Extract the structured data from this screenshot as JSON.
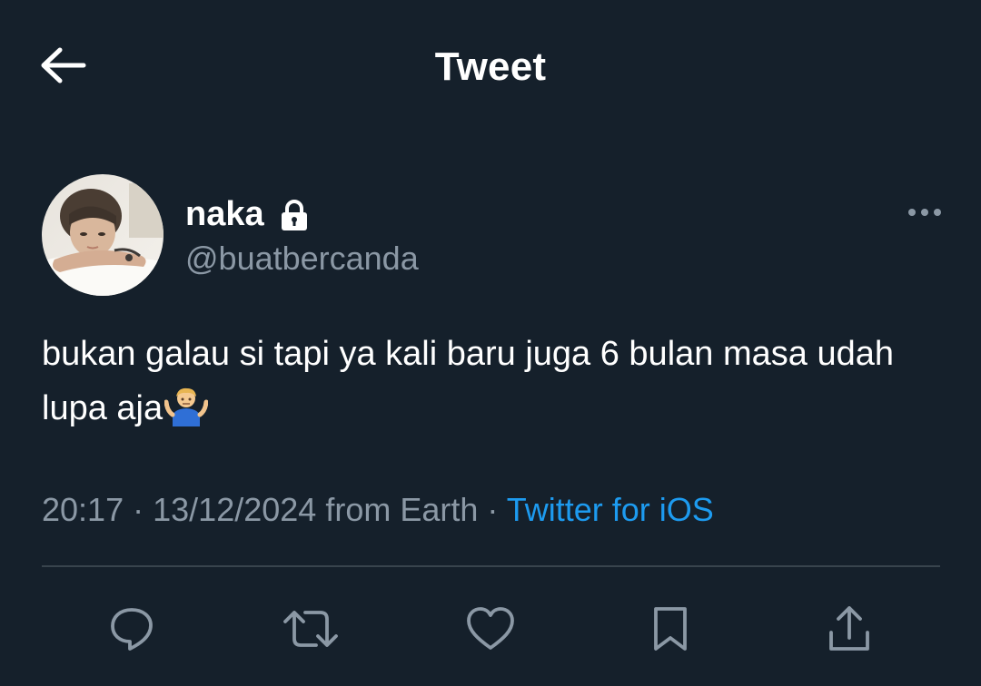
{
  "header": {
    "title": "Tweet",
    "back_icon": "arrow-left-icon"
  },
  "tweet": {
    "author": {
      "name": "naka",
      "handle": "@buatbercanda",
      "protected_icon": "lock-icon",
      "avatar": "avatar-photo"
    },
    "text_before_emoji": "bukan galau si tapi ya kali baru juga 6 bulan masa udah lupa aja",
    "emoji": "person-shrugging-emoji",
    "time": "20:17",
    "date": "13/12/2024",
    "location": "from Earth",
    "separator": "·",
    "source": "Twitter for iOS",
    "more_icon": "more-horizontal-icon"
  },
  "actions": [
    {
      "name": "reply",
      "icon": "reply-icon"
    },
    {
      "name": "retweet",
      "icon": "retweet-icon"
    },
    {
      "name": "like",
      "icon": "heart-icon"
    },
    {
      "name": "bookmark",
      "icon": "bookmark-icon"
    },
    {
      "name": "share",
      "icon": "share-icon"
    }
  ],
  "colors": {
    "background": "#15202b",
    "primary_text": "#ffffff",
    "secondary_text": "#8b98a5",
    "accent": "#1d9bf0",
    "divider": "#38444d",
    "icon": "#8b98a5"
  }
}
